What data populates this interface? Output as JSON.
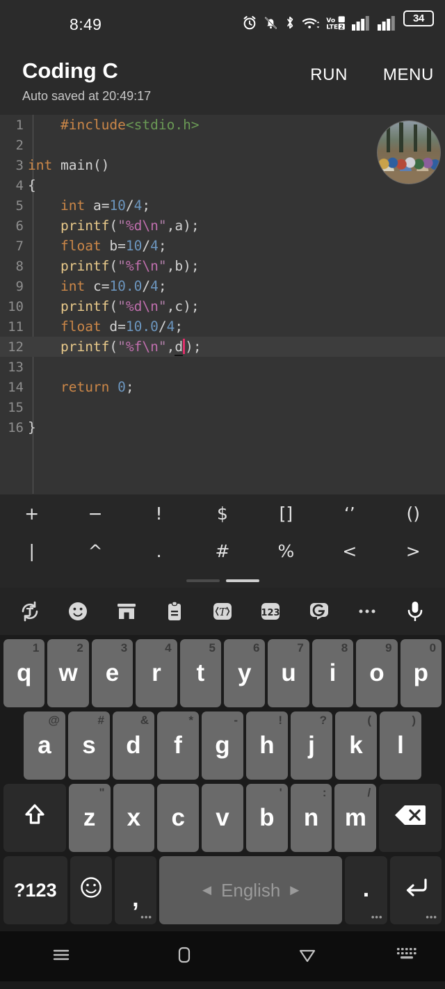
{
  "status_bar": {
    "clock": "8:49",
    "battery_percent": "34",
    "icons": [
      "alarm-icon",
      "bell-off-icon",
      "bluetooth-icon",
      "wifi-icon",
      "volte-icon",
      "signal-1-icon",
      "signal-2-icon",
      "battery-icon"
    ],
    "volte_label_top": "Vo",
    "volte_label_bottom": "LTE",
    "volte_sim": "2"
  },
  "app_bar": {
    "title": "Coding C",
    "subtitle": "Auto saved at 20:49:17",
    "run_label": "RUN",
    "menu_label": "MENU"
  },
  "editor": {
    "active_line": 12,
    "lines": [
      {
        "n": "1",
        "text": "    #include<stdio.h>"
      },
      {
        "n": "2",
        "text": ""
      },
      {
        "n": "3",
        "text": "int main()"
      },
      {
        "n": "4",
        "text": "{"
      },
      {
        "n": "5",
        "text": "    int a=10/4;"
      },
      {
        "n": "6",
        "text": "    printf(\"%d\\n\",a);"
      },
      {
        "n": "7",
        "text": "    float b=10/4;"
      },
      {
        "n": "8",
        "text": "    printf(\"%f\\n\",b);"
      },
      {
        "n": "9",
        "text": "    int c=10.0/4;"
      },
      {
        "n": "10",
        "text": "    printf(\"%d\\n\",c);"
      },
      {
        "n": "11",
        "text": "    float d=10.0/4;"
      },
      {
        "n": "12",
        "text": "    printf(\"%f\\n\",d);"
      },
      {
        "n": "13",
        "text": ""
      },
      {
        "n": "14",
        "text": "    return 0;"
      },
      {
        "n": "15",
        "text": ""
      },
      {
        "n": "16",
        "text": "}"
      }
    ],
    "colors": {
      "background": "#343434",
      "active_line_bg": "#3d3d3d",
      "gutter_text": "#8e8e8e",
      "keyword": "#cc8748",
      "function": "#e8c98a",
      "string": "#b07fa8",
      "number": "#6c96bf",
      "header": "#6a9955",
      "caret": "#e0306b"
    }
  },
  "symbol_panel": {
    "row1": [
      "+",
      "−",
      "!",
      "$",
      "[]",
      "‘’",
      "()"
    ],
    "row2": [
      "|",
      "^",
      ".",
      "#",
      "%",
      "<",
      ">"
    ],
    "page_current": 2,
    "page_total": 2
  },
  "kb_toolbar": {
    "items": [
      "rotate-text-icon",
      "emoji-icon",
      "sticker-store-icon",
      "clipboard-icon",
      "text-format-icon",
      "numbers-123-icon",
      "assistant-icon",
      "more-options-icon",
      "microphone-icon"
    ],
    "numbers_label": "123"
  },
  "keyboard": {
    "row1": [
      {
        "key": "q",
        "hint": "1"
      },
      {
        "key": "w",
        "hint": "2"
      },
      {
        "key": "e",
        "hint": "3"
      },
      {
        "key": "r",
        "hint": "4"
      },
      {
        "key": "t",
        "hint": "5"
      },
      {
        "key": "y",
        "hint": "6"
      },
      {
        "key": "u",
        "hint": "7"
      },
      {
        "key": "i",
        "hint": "8"
      },
      {
        "key": "o",
        "hint": "9"
      },
      {
        "key": "p",
        "hint": "0"
      }
    ],
    "row2": [
      {
        "key": "a",
        "hint": "@"
      },
      {
        "key": "s",
        "hint": "#"
      },
      {
        "key": "d",
        "hint": "&"
      },
      {
        "key": "f",
        "hint": "*"
      },
      {
        "key": "g",
        "hint": "-"
      },
      {
        "key": "h",
        "hint": "!"
      },
      {
        "key": "j",
        "hint": "?"
      },
      {
        "key": "k",
        "hint": "("
      },
      {
        "key": "l",
        "hint": ")"
      }
    ],
    "row3": [
      {
        "key": "z",
        "hint": "\""
      },
      {
        "key": "x",
        "hint": ""
      },
      {
        "key": "c",
        "hint": ""
      },
      {
        "key": "v",
        "hint": ""
      },
      {
        "key": "b",
        "hint": "'"
      },
      {
        "key": "n",
        "hint": ":"
      },
      {
        "key": "m",
        "hint": "/"
      }
    ],
    "shift_icon": "shift-icon",
    "backspace_icon": "backspace-icon",
    "row4": {
      "symbols_label": "?123",
      "emoji_icon": "emoji-smiley-icon",
      "comma_label": ",",
      "space_label": "English",
      "space_prev_icon": "◀",
      "space_next_icon": "▶",
      "period_label": ".",
      "enter_icon": "enter-icon",
      "long_press_dots": "•••"
    }
  },
  "nav_bar": {
    "items": [
      "recents-icon",
      "home-icon",
      "back-icon",
      "hide-keyboard-icon"
    ]
  }
}
